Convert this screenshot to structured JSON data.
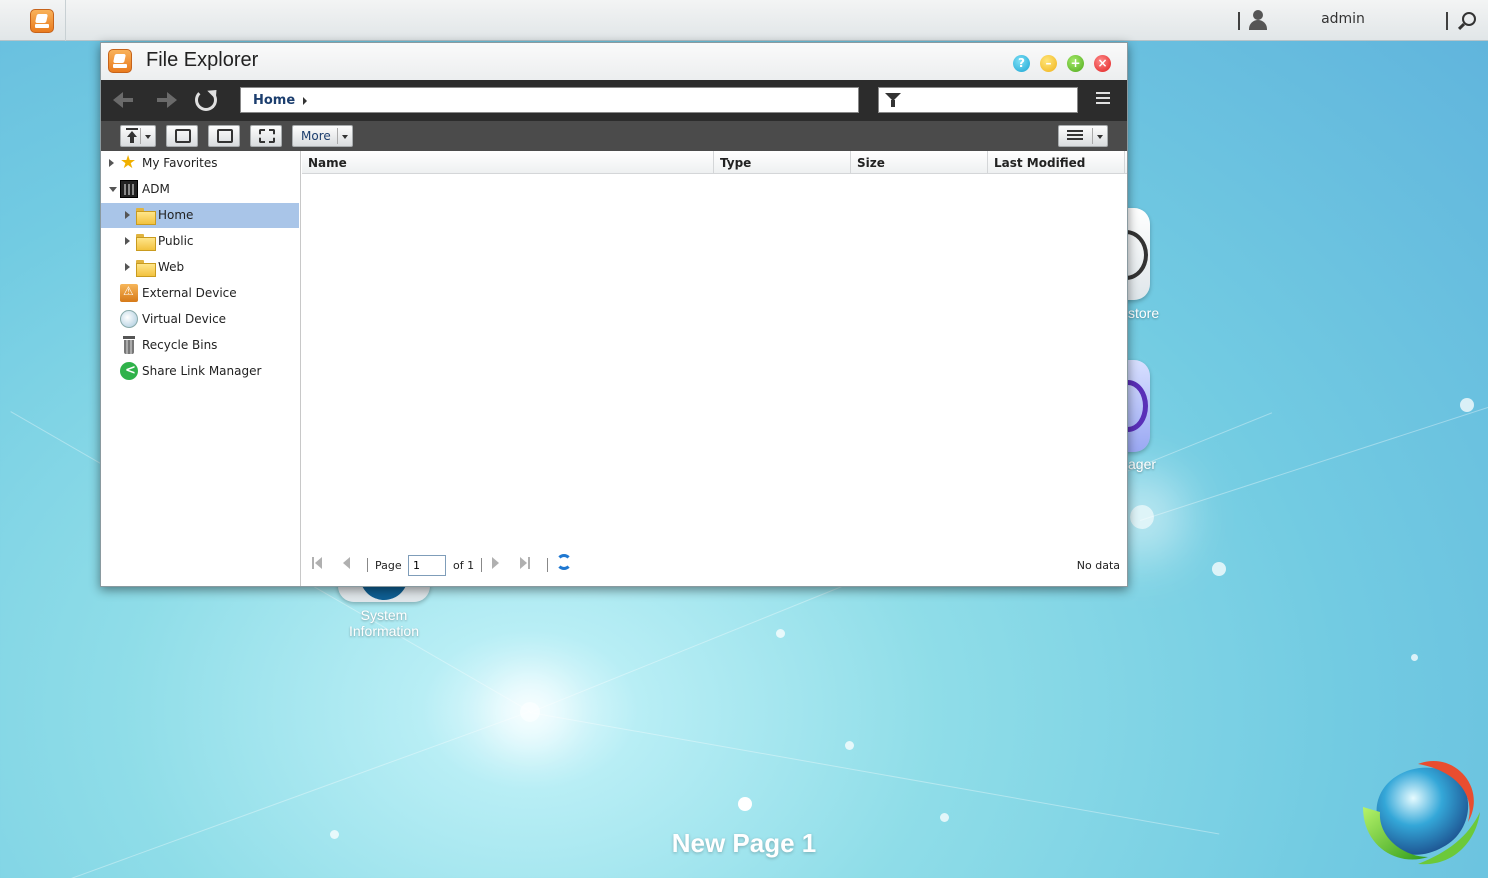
{
  "taskbar": {
    "username": "admin"
  },
  "desktop": {
    "icons": [
      {
        "label": "store"
      },
      {
        "label": "ager"
      },
      {
        "label_line1": "System",
        "label_line2": "Information"
      }
    ],
    "page_title": "New Page 1"
  },
  "window": {
    "title": "File Explorer",
    "path": "Home",
    "filter_placeholder": "",
    "toolbar": {
      "more_label": "More"
    },
    "tree": [
      {
        "label": "My Favorites",
        "icon": "star-icon",
        "expanded": false
      },
      {
        "label": "ADM",
        "icon": "server-icon",
        "expanded": true
      },
      {
        "label": "Home",
        "icon": "folder-icon",
        "selected": true
      },
      {
        "label": "Public",
        "icon": "folder-icon"
      },
      {
        "label": "Web",
        "icon": "folder-icon"
      },
      {
        "label": "External Device",
        "icon": "external-device-icon"
      },
      {
        "label": "Virtual Device",
        "icon": "virtual-device-icon"
      },
      {
        "label": "Recycle Bins",
        "icon": "recycle-bin-icon"
      },
      {
        "label": "Share Link Manager",
        "icon": "share-icon"
      }
    ],
    "columns": [
      "Name",
      "Type",
      "Size",
      "Last Modified"
    ],
    "pager": {
      "page_label": "Page",
      "page_value": "1",
      "of_label": "of 1",
      "status": "No data"
    }
  },
  "colors": {
    "selection": "#a9c5e8",
    "navbar": "#2c2c2c",
    "toolbar": "#4b4b4b",
    "path_text": "#1c3e6e"
  }
}
